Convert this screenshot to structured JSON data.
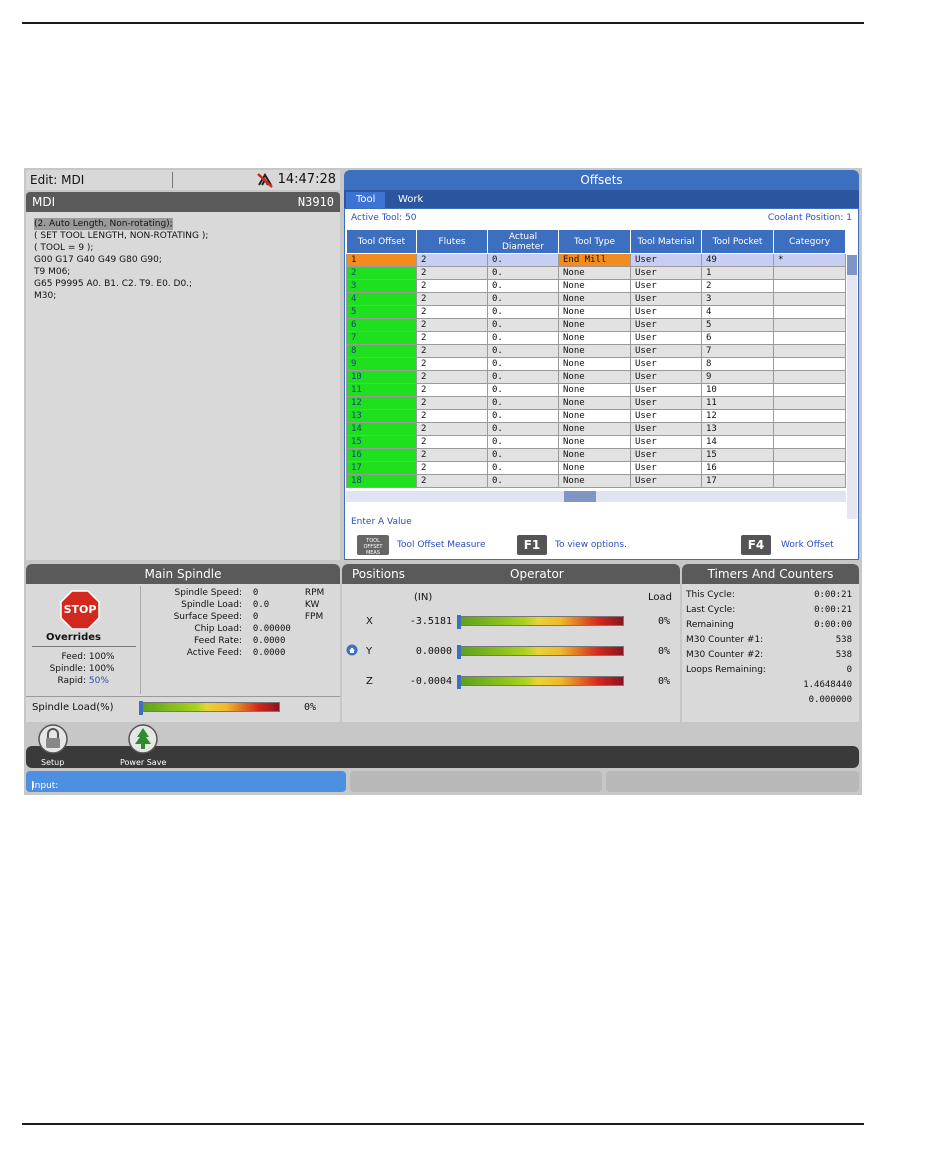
{
  "edit": {
    "mode": "Edit: MDI",
    "clock": "14:47:28"
  },
  "mdi": {
    "title": "MDI",
    "block": "N3910",
    "lines": [
      "(2. Auto Length, Non-rotating);",
      "( SET TOOL LENGTH, NON-ROTATING );",
      "( TOOL = 9 );",
      "G00 G17 G40 G49 G80 G90;",
      "T9 M06;",
      "G65 P9995 A0. B1. C2. T9. E0. D0.;",
      "M30;"
    ]
  },
  "offsets": {
    "title": "Offsets",
    "tabs": [
      "Tool",
      "Work"
    ],
    "active_tool": "Active Tool: 50",
    "coolant": "Coolant Position: 1",
    "columns": [
      "Tool Offset",
      "Flutes",
      "Actual\nDiameter",
      "Tool Type",
      "Tool Material",
      "Tool Pocket",
      "Category"
    ],
    "rows": [
      [
        "1",
        "2",
        "0.",
        "End Mill",
        "User",
        "49",
        "*"
      ],
      [
        "2",
        "2",
        "0.",
        "None",
        "User",
        "1",
        ""
      ],
      [
        "3",
        "2",
        "0.",
        "None",
        "User",
        "2",
        ""
      ],
      [
        "4",
        "2",
        "0.",
        "None",
        "User",
        "3",
        ""
      ],
      [
        "5",
        "2",
        "0.",
        "None",
        "User",
        "4",
        ""
      ],
      [
        "6",
        "2",
        "0.",
        "None",
        "User",
        "5",
        ""
      ],
      [
        "7",
        "2",
        "0.",
        "None",
        "User",
        "6",
        ""
      ],
      [
        "8",
        "2",
        "0.",
        "None",
        "User",
        "7",
        ""
      ],
      [
        "9",
        "2",
        "0.",
        "None",
        "User",
        "8",
        ""
      ],
      [
        "10",
        "2",
        "0.",
        "None",
        "User",
        "9",
        ""
      ],
      [
        "11",
        "2",
        "0.",
        "None",
        "User",
        "10",
        ""
      ],
      [
        "12",
        "2",
        "0.",
        "None",
        "User",
        "11",
        ""
      ],
      [
        "13",
        "2",
        "0.",
        "None",
        "User",
        "12",
        ""
      ],
      [
        "14",
        "2",
        "0.",
        "None",
        "User",
        "13",
        ""
      ],
      [
        "15",
        "2",
        "0.",
        "None",
        "User",
        "14",
        ""
      ],
      [
        "16",
        "2",
        "0.",
        "None",
        "User",
        "15",
        ""
      ],
      [
        "17",
        "2",
        "0.",
        "None",
        "User",
        "16",
        ""
      ],
      [
        "18",
        "2",
        "0.",
        "None",
        "User",
        "17",
        ""
      ]
    ],
    "prompt": "Enter A Value",
    "keys": {
      "measure_icon": "TOOL OFFSET MEAS",
      "measure_label": "Tool Offset Measure",
      "f1": "F1",
      "f1_label": "To view options.",
      "f4": "F4",
      "f4_label": "Work Offset"
    }
  },
  "spindle": {
    "title": "Main Spindle",
    "stop": "STOP",
    "overrides_title": "Overrides",
    "overrides": [
      {
        "k": "Feed:",
        "v": "100%"
      },
      {
        "k": "Spindle:",
        "v": "100%"
      },
      {
        "k": "Rapid:",
        "v": "50%"
      }
    ],
    "stats": [
      {
        "k": "Spindle Speed:",
        "v": "0",
        "u": "RPM"
      },
      {
        "k": "Spindle Load:",
        "v": "0.0",
        "u": "KW"
      },
      {
        "k": "Surface Speed:",
        "v": "0",
        "u": "FPM"
      },
      {
        "k": "Chip Load:",
        "v": "0.00000",
        "u": ""
      },
      {
        "k": "Feed Rate:",
        "v": "0.0000",
        "u": ""
      },
      {
        "k": "Active Feed:",
        "v": "0.0000",
        "u": ""
      }
    ],
    "load_label": "Spindle Load(%)",
    "load_pct": "0%",
    "load_value": 0
  },
  "positions": {
    "title": "Positions",
    "mode": "Operator",
    "units": "(IN)",
    "load_header": "Load",
    "axes": [
      {
        "axis": "X",
        "value": "-3.5181",
        "load": "0%",
        "fraction": 0
      },
      {
        "axis": "Y",
        "value": "0.0000",
        "load": "0%",
        "fraction": 0
      },
      {
        "axis": "Z",
        "value": "-0.0004",
        "load": "0%",
        "fraction": 0
      }
    ]
  },
  "timers": {
    "title": "Timers And Counters",
    "rows": [
      {
        "k": "This Cycle:",
        "v": "0:00:21"
      },
      {
        "k": "Last Cycle:",
        "v": "0:00:21"
      },
      {
        "k": "Remaining",
        "v": "0:00:00"
      },
      {
        "k": "M30 Counter #1:",
        "v": "538"
      },
      {
        "k": "M30 Counter #2:",
        "v": "538"
      },
      {
        "k": "Loops Remaining:",
        "v": "0"
      },
      {
        "k": "",
        "v": "1.4648440"
      },
      {
        "k": "",
        "v": "0.000000"
      }
    ]
  },
  "bottom": {
    "setup": "Setup",
    "power_save": "Power Save",
    "input_label": "Input:"
  },
  "colors": {
    "header_blue": "#3d6fc1",
    "header_gray": "#5a5a5a",
    "active_orange": "#f28c1e",
    "offset_green": "#1ee01e",
    "stop_red": "#d2281e"
  }
}
